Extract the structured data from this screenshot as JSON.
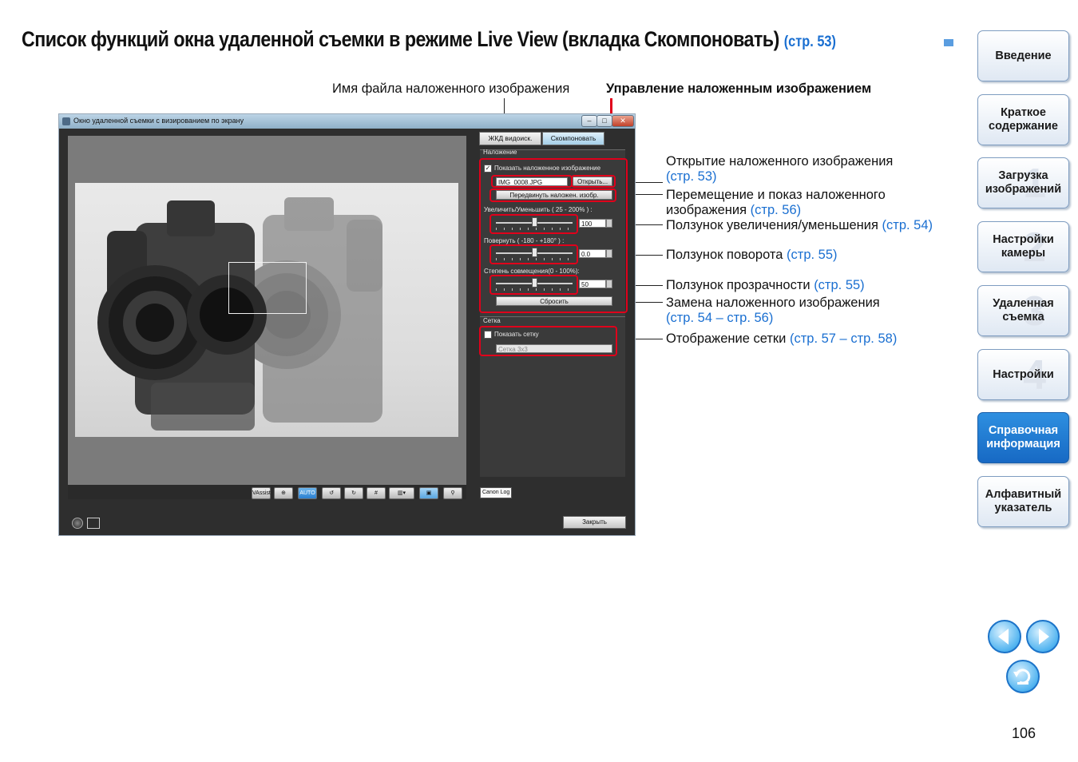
{
  "title": {
    "main": "Список функций окна удаленной съемки в режиме Live View (вкладка Скомпоновать)",
    "ref": "(стр. 53)"
  },
  "top_labels": {
    "filename": "Имя файла наложенного изображения",
    "control": "Управление наложенным изображением"
  },
  "callouts": [
    {
      "text": "Открытие наложенного изображения",
      "text2": "",
      "ref": "(стр. 53)"
    },
    {
      "text": "Перемещение и показ наложенного",
      "text2": "изображения",
      "ref": "(стр. 56)"
    },
    {
      "text": "Ползунок увеличения/уменьшения",
      "text2": "",
      "ref": "(стр. 54)"
    },
    {
      "text": "Ползунок поворота",
      "text2": "",
      "ref": "(стр. 55)"
    },
    {
      "text": "Ползунок прозрачности",
      "text2": "",
      "ref": "(стр. 55)"
    },
    {
      "text": "Замена наложенного изображения",
      "text2": "",
      "ref": "(стр. 54 – стр. 56)"
    },
    {
      "text": "Отображение сетки",
      "text2": "",
      "ref": "(стр. 57 – стр. 58)"
    }
  ],
  "window": {
    "title": "Окно удаленной съемки с визированием по экрану",
    "tabs": [
      "ЖКД видоиск.",
      "Скомпоновать"
    ],
    "overlay_group": "Наложение",
    "show_overlay": "Показать наложенное изображение",
    "filename_value": "IMG_0008.JPG",
    "open_button": "Открыть...",
    "move_button": "Передвинуть наложен. изобр.",
    "zoom_label": "Увеличить/Уменьшить ( 25 - 200% ) :",
    "zoom_value": "100",
    "rotate_label": "Повернуть ( -180 - +180° ) :",
    "rotate_value": "0.0",
    "blend_label": "Степень совмещения(0 - 100%):",
    "blend_value": "50",
    "reset_button": "Сбросить",
    "grid_group": "Сетка",
    "show_grid": "Показать сетку",
    "grid_select": "Сетка 3x3",
    "canon_log": "Canon Log",
    "close_button": "Закрыть",
    "toolbar": [
      "VAssist",
      "AUTO"
    ],
    "zoom_slider": 0.5,
    "rotate_slider": 0.5,
    "blend_slider": 0.5
  },
  "sidebar": [
    {
      "label": "Введение",
      "num": ""
    },
    {
      "label": "Краткое содержание",
      "num": ""
    },
    {
      "label": "Загрузка изображений",
      "num": "1"
    },
    {
      "label": "Настройки камеры",
      "num": "2"
    },
    {
      "label": "Удаленная съемка",
      "num": "3"
    },
    {
      "label": "Настройки",
      "num": "4"
    },
    {
      "label": "Справочная информация",
      "num": ""
    },
    {
      "label": "Алфавитный указатель",
      "num": ""
    }
  ],
  "page_number": "106",
  "colors": {
    "accent": "#1a6fd1",
    "highlight_red": "#e0001b",
    "active_nav": "#1769c4"
  }
}
